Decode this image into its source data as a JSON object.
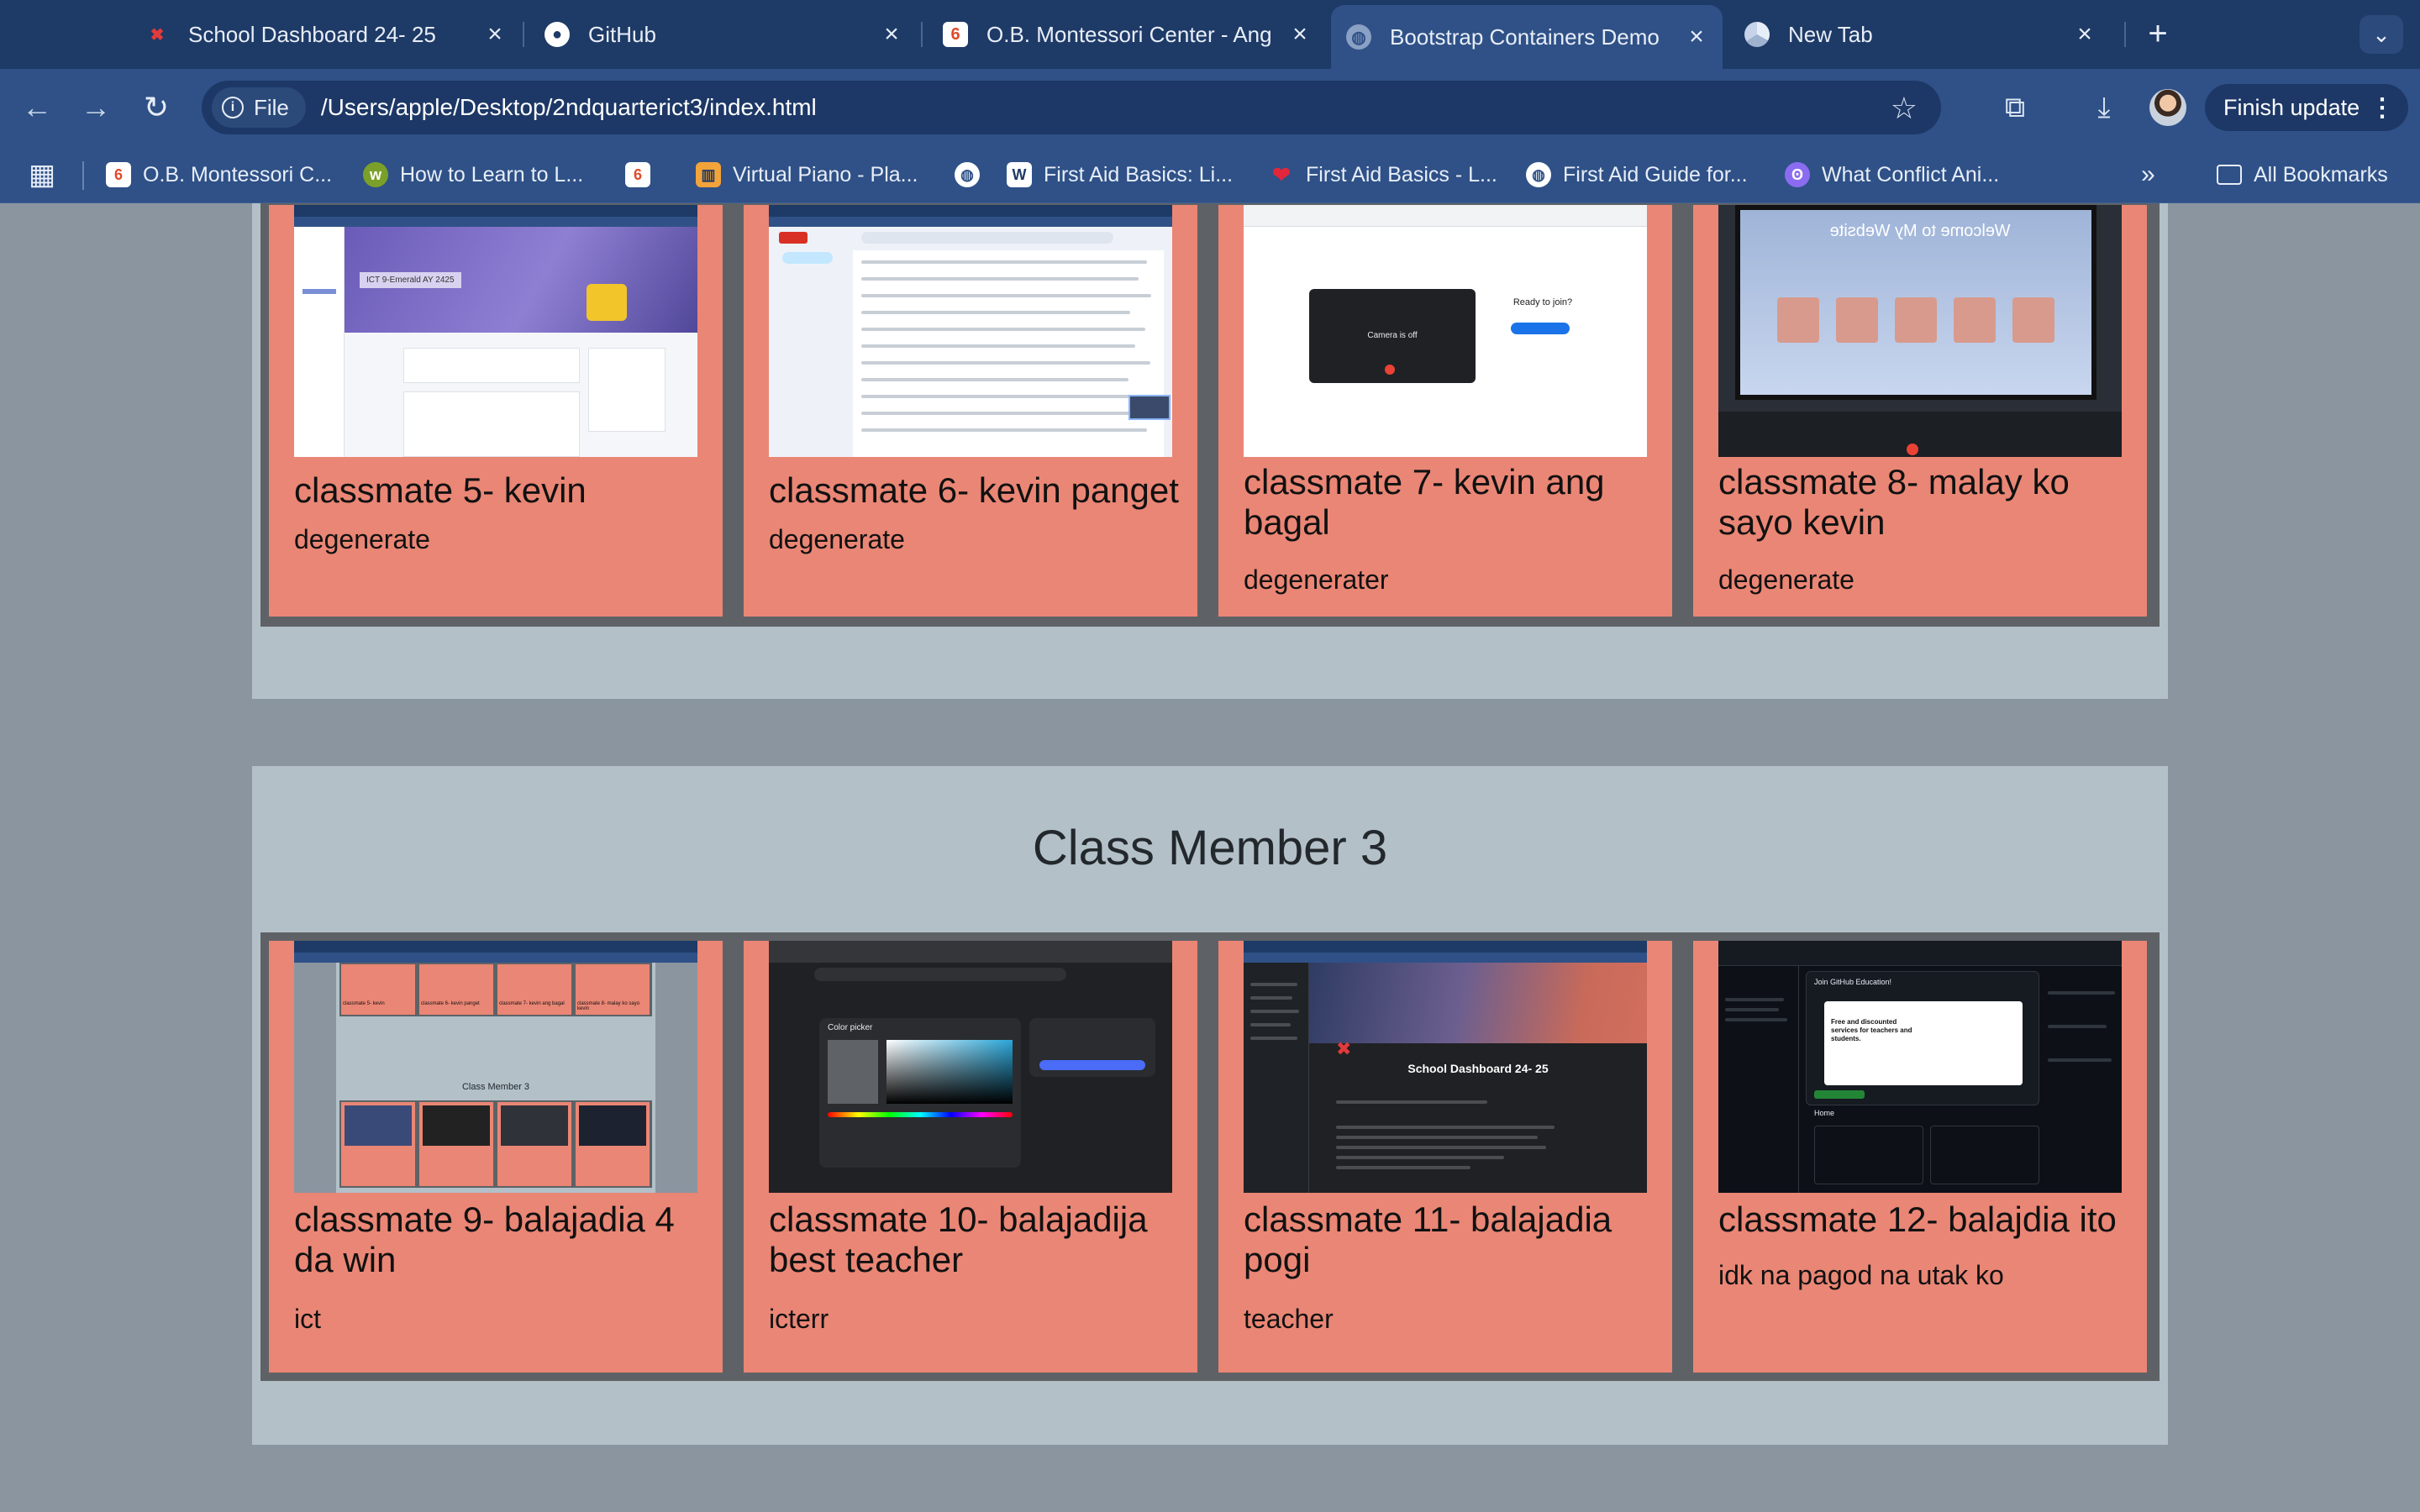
{
  "browser": {
    "tabs": [
      {
        "title": "School Dashboard 24- 25",
        "icon": "school-dashboard-icon"
      },
      {
        "title": "GitHub",
        "icon": "github-icon"
      },
      {
        "title": "O.B. Montessori Center - Ang",
        "icon": "ob-montessori-icon"
      },
      {
        "title": "Bootstrap Containers Demo",
        "icon": "globe-icon"
      },
      {
        "title": "New Tab",
        "icon": "chrome-icon"
      }
    ],
    "new_tab_symbol": "+",
    "tab_menu_symbol": "⌄",
    "site_chip": "File",
    "url": "/Users/apple/Desktop/2ndquarterict3/index.html",
    "update_button": "Finish update",
    "bookmarks": [
      {
        "label": "O.B. Montessori C...",
        "icon": "ob-montessori-icon"
      },
      {
        "label": "How to Learn to L...",
        "icon": "wikihow-icon"
      },
      {
        "label": "",
        "icon": "ob-montessori-icon"
      },
      {
        "label": "Virtual Piano - Pla...",
        "icon": "piano-icon"
      },
      {
        "label": "",
        "icon": "globe-icon"
      },
      {
        "label": "First Aid Basics: Li...",
        "icon": "w-icon"
      },
      {
        "label": "First Aid Basics - L...",
        "icon": "heart-icon"
      },
      {
        "label": "First Aid Guide for...",
        "icon": "globe-icon"
      },
      {
        "label": "What Conflict Ani...",
        "icon": "conflict-icon"
      }
    ],
    "all_bookmarks": "All Bookmarks"
  },
  "sections": [
    {
      "title": "",
      "cards": [
        {
          "title": "classmate 5- kevin",
          "desc": "degenerate",
          "thumb": "google-classroom"
        },
        {
          "title": "classmate 6- kevin panget",
          "desc": "degenerate",
          "thumb": "gmail-inbox"
        },
        {
          "title": "classmate 7- kevin ang bagal",
          "desc": "degenerater",
          "thumb": "google-meet"
        },
        {
          "title": "classmate 8- malay ko sayo kevin",
          "desc": "degenerate",
          "thumb": "tv-photo"
        }
      ]
    },
    {
      "title": "Class Member 3",
      "cards": [
        {
          "title": "classmate 9- balajadia 4 da win",
          "desc": "ict",
          "thumb": "page-screenshot"
        },
        {
          "title": "classmate 10- balajadija best teacher",
          "desc": "icterr",
          "thumb": "color-picker"
        },
        {
          "title": "classmate 11- balajadia pogi",
          "desc": "teacher",
          "thumb": "school-dashboard"
        },
        {
          "title": "classmate 12- balajdia ito",
          "desc": "idk na pagod na utak ko",
          "thumb": "github-dashboard"
        }
      ]
    }
  ],
  "thumb_text": {
    "classroom_banner": "ICT 9-Emerald AY 2425",
    "meet_camera": "Camera is off",
    "meet_ready": "Ready to join?",
    "tv_banner": "Welcome to My Website",
    "mini_section": "Class Member 3",
    "mini_cards": [
      "classmate 5- kevin",
      "classmate 6- kevin panget",
      "classmate 7- kevin ang bagal",
      "classmate 8- malay ko sayo kevin"
    ],
    "color_picker": "Color picker",
    "dashboard_title": "School Dashboard 24- 25",
    "github_join": "Join GitHub Education!",
    "github_offer": "Free and discounted services for teachers and students.",
    "github_home": "Home"
  },
  "colors": {
    "tabbar": "#1e3a66",
    "toolbar": "#2f5187",
    "page_bg": "#8a95a0",
    "section_bg": "#b3c0c8",
    "row_bg": "#5e6266",
    "card_bg": "#ea8675"
  }
}
